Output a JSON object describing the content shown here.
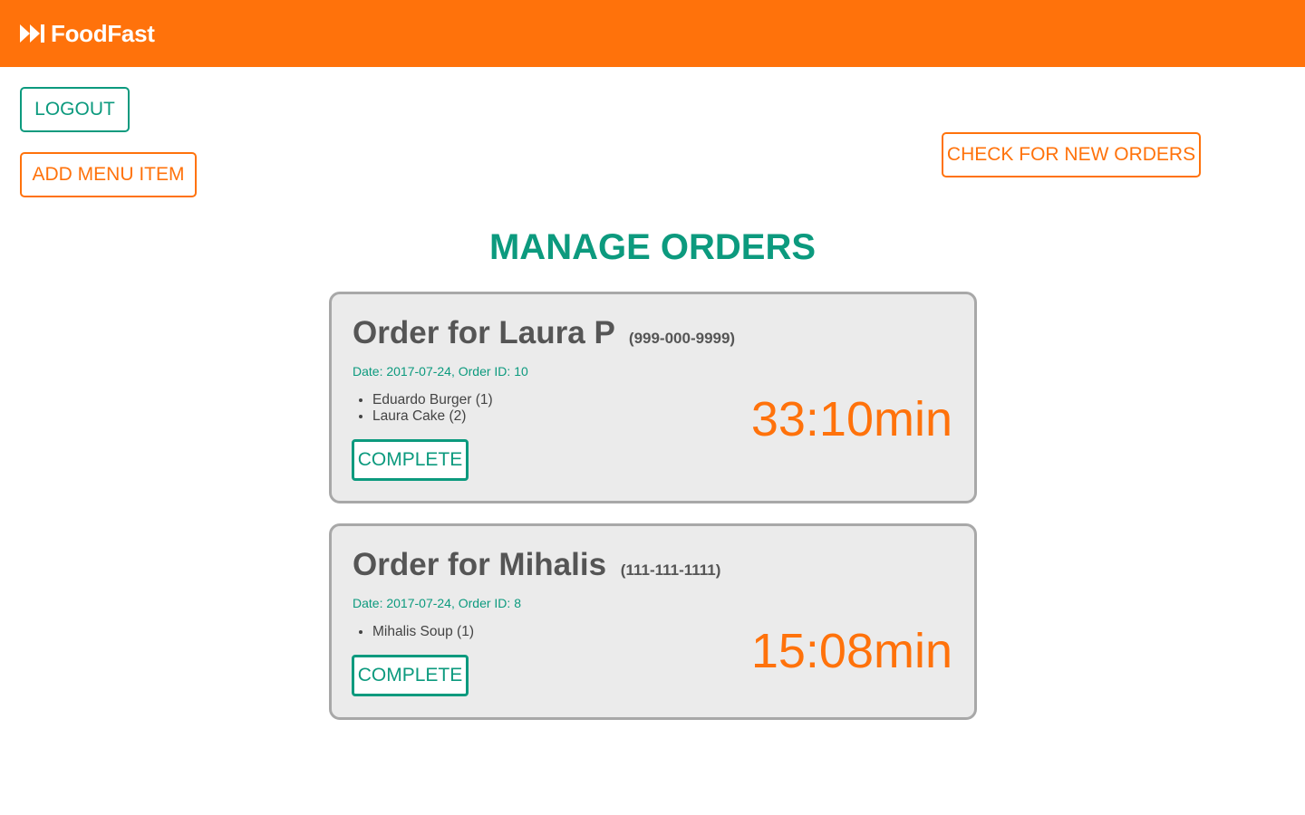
{
  "header": {
    "brand": "FoodFast",
    "brand_icon": "fast-forward-icon",
    "background_color": "#ff720b"
  },
  "actions": {
    "logout_label": "LOGOUT",
    "add_menu_item_label": "ADD MENU ITEM",
    "check_new_orders_label": "CHECK FOR NEW ORDERS"
  },
  "page": {
    "title": "MANAGE ORDERS"
  },
  "colors": {
    "accent_orange": "#ff720b",
    "accent_teal": "#0c9a7e",
    "card_background": "#ebebeb"
  },
  "orders": [
    {
      "title": "Order for Laura P",
      "phone": "(999-000-9999)",
      "meta": "Date: 2017-07-24, Order ID: 10",
      "items": [
        "Eduardo Burger (1)",
        "Laura Cake (2)"
      ],
      "elapsed": "33:10min",
      "complete_label": "COMPLETE"
    },
    {
      "title": "Order for Mihalis",
      "phone": "(111-111-1111)",
      "meta": "Date: 2017-07-24, Order ID: 8",
      "items": [
        "Mihalis Soup (1)"
      ],
      "elapsed": "15:08min",
      "complete_label": "COMPLETE"
    }
  ]
}
